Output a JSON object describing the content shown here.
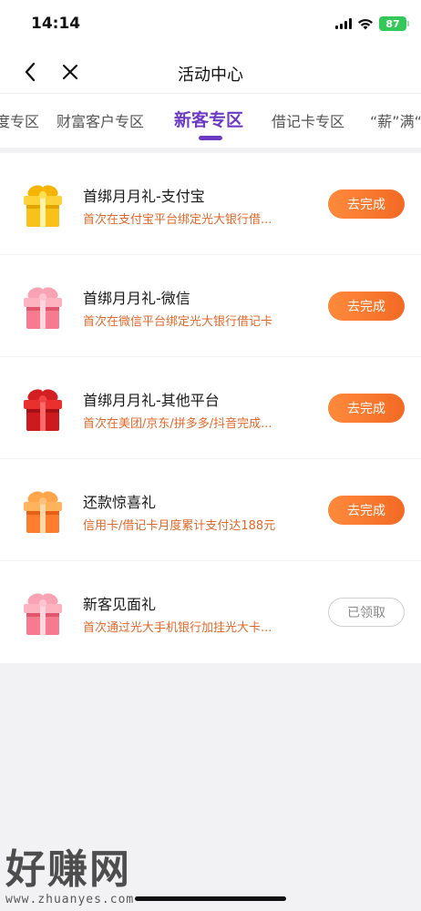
{
  "status": {
    "time": "14:14",
    "battery": "87"
  },
  "nav": {
    "title": "活动中心",
    "back_icon": "chevron-left-icon",
    "close_icon": "close-icon"
  },
  "tabs": [
    {
      "label": "度专区"
    },
    {
      "label": "财富客户专区"
    },
    {
      "label": "新客专区"
    },
    {
      "label": "借记卡专区"
    },
    {
      "label": "“薪”满“"
    }
  ],
  "active_tab": "新客专区",
  "tasks": [
    {
      "title": "首绑月月礼-支付宝",
      "desc": "首次在支付宝平台绑定光大银行借...",
      "button": "去完成",
      "icon": "gold-gift-icon"
    },
    {
      "title": "首绑月月礼-微信",
      "desc": "首次在微信平台绑定光大银行借记卡",
      "button": "去完成",
      "icon": "pink-gift-icon"
    },
    {
      "title": "首绑月月礼-其他平台",
      "desc": "首次在美团/京东/拼多多/抖音完成...",
      "button": "去完成",
      "icon": "red-gift-icon"
    },
    {
      "title": "还款惊喜礼",
      "desc": "信用卡/借记卡月度累计支付达188元",
      "button": "去完成",
      "icon": "orange-gift-icon"
    },
    {
      "title": "新客见面礼",
      "desc": "首次通过光大手机银行加挂光大卡...",
      "button": "已领取",
      "icon": "pink-gift-icon"
    }
  ],
  "watermark": {
    "main": "好赚网",
    "url": "www.zhuanyes.com"
  },
  "colors": {
    "accent": "#6c3bc4",
    "button": "#f26a25",
    "desc": "#e0682a"
  }
}
